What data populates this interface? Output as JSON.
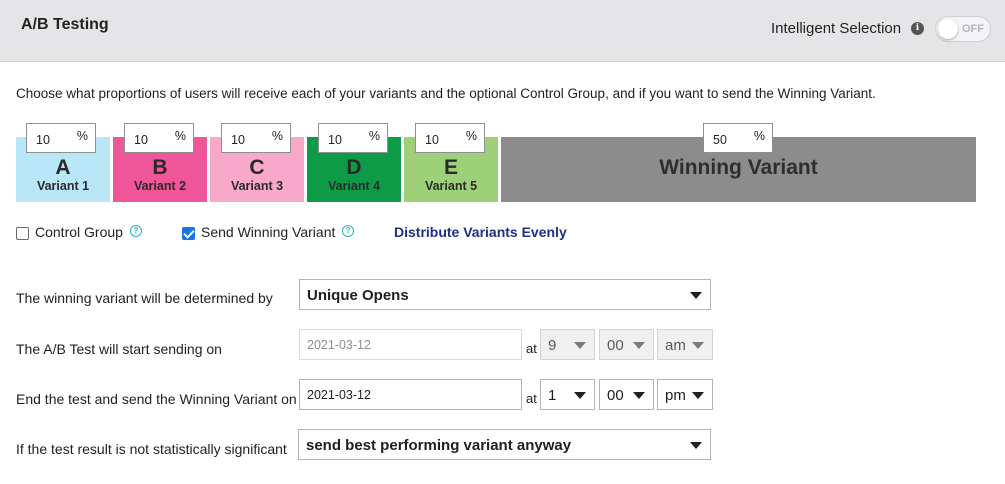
{
  "header": {
    "title": "A/B Testing",
    "intelligent_label": "Intelligent Selection",
    "info_glyph": "i",
    "toggle_text": "OFF"
  },
  "intro_text": "Choose what proportions of users will receive each of your variants and the optional Control Group, and if you want to send the Winning Variant.",
  "percent_sign": "%",
  "variants": [
    {
      "letter": "A",
      "name": "Variant 1",
      "percent": "10",
      "color": "#b9e7f7"
    },
    {
      "letter": "B",
      "name": "Variant 2",
      "percent": "10",
      "color": "#f0569a"
    },
    {
      "letter": "C",
      "name": "Variant 3",
      "percent": "10",
      "color": "#f8a8c9"
    },
    {
      "letter": "D",
      "name": "Variant 4",
      "percent": "10",
      "color": "#0e9b48"
    },
    {
      "letter": "E",
      "name": "Variant 5",
      "percent": "10",
      "color": "#9ed07a"
    }
  ],
  "winning": {
    "label": "Winning Variant",
    "percent": "50",
    "color": "#8c8c8c"
  },
  "options": {
    "control_group_label": "Control Group",
    "control_group_checked": false,
    "send_winning_label": "Send Winning Variant",
    "send_winning_checked": true,
    "help_glyph": "?",
    "distribute_link": "Distribute Variants Evenly"
  },
  "settings": {
    "determined_label": "The winning variant will be determined by",
    "determined_value": "Unique Opens",
    "start_label": "The A/B Test will start sending on",
    "start_date": "2021-03-12",
    "start_at": "at",
    "start_hour": "9",
    "start_minute": "00",
    "start_ampm": "am",
    "end_label": "End the test and send the Winning Variant on",
    "end_date": "2021-03-12",
    "end_at": "at",
    "end_hour": "1",
    "end_minute": "00",
    "end_ampm": "pm",
    "insignificant_label": "If the test result is not statistically significant",
    "insignificant_value": "send best performing variant anyway"
  }
}
